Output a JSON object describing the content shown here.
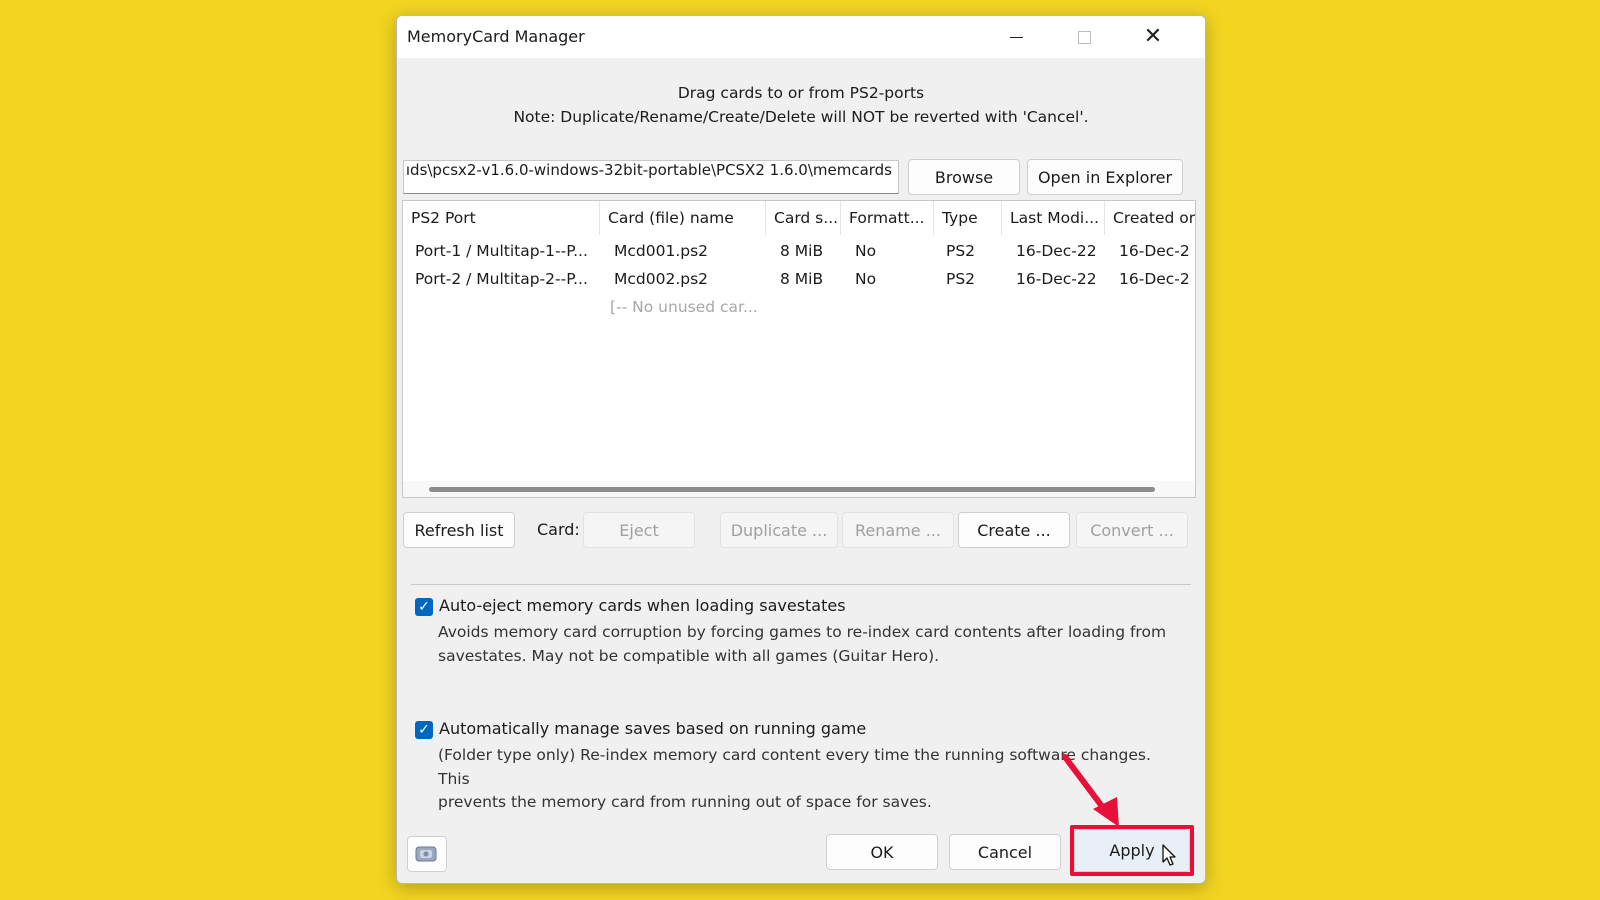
{
  "window": {
    "title": "MemoryCard Manager"
  },
  "hints": {
    "line1": "Drag cards to or from PS2-ports",
    "line2": "Note: Duplicate/Rename/Create/Delete will NOT be reverted with 'Cancel'."
  },
  "path": {
    "value": "ıds\\pcsx2-v1.6.0-windows-32bit-portable\\PCSX2 1.6.0\\memcards",
    "browse_label": "Browse",
    "explorer_label": "Open in Explorer"
  },
  "list": {
    "columns": [
      "PS2 Port",
      "Card (file) name",
      "Card s...",
      "Formatt...",
      "Type",
      "Last Modi...",
      "Created or"
    ],
    "rows": [
      [
        "Port-1 / Multitap-1--P...",
        "Mcd001.ps2",
        "8 MiB",
        "No",
        "PS2",
        "16-Dec-22",
        "16-Dec-2"
      ],
      [
        "Port-2 / Multitap-2--P...",
        "Mcd002.ps2",
        "8 MiB",
        "No",
        "PS2",
        "16-Dec-22",
        "16-Dec-2"
      ]
    ],
    "empty_text": "[-- No unused car..."
  },
  "card_actions": {
    "refresh_label": "Refresh list",
    "card_label": "Card:",
    "eject_label": "Eject",
    "duplicate_label": "Duplicate ...",
    "rename_label": "Rename ...",
    "create_label": "Create ...",
    "convert_label": "Convert ..."
  },
  "options": {
    "auto_eject": {
      "checked": true,
      "label": "Auto-eject memory cards when loading savestates",
      "desc1": "Avoids memory card corruption by forcing games to re-index card contents after loading from",
      "desc2": "savestates.  May not be compatible with all games (Guitar Hero)."
    },
    "auto_manage": {
      "checked": true,
      "label": "Automatically manage saves based on running game",
      "desc1": "(Folder type only) Re-index memory card content every time the running software changes. This",
      "desc2": "prevents the memory card from running out of space for saves."
    }
  },
  "footer": {
    "ok_label": "OK",
    "cancel_label": "Cancel",
    "apply_label": "Apply"
  },
  "colors": {
    "background": "#f2d421",
    "annotation": "#e8103a",
    "checkbox": "#0067c0"
  }
}
